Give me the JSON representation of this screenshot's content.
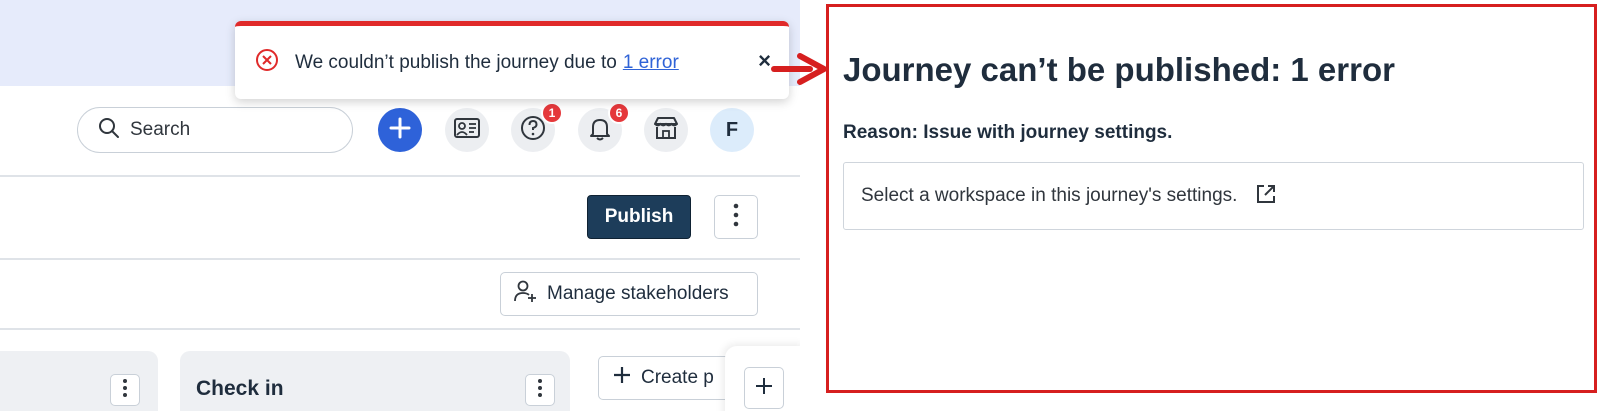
{
  "toast": {
    "message": "We couldn’t publish the journey due to",
    "link": "1 error",
    "close": "×"
  },
  "header": {
    "search_label": "Search",
    "help_badge": "1",
    "notifications_badge": "6",
    "avatar_initial": "F"
  },
  "toolbar": {
    "publish_label": "Publish",
    "manage_stakeholders_label": "Manage stakeholders"
  },
  "stages": [
    {
      "title": ""
    },
    {
      "title": "Check in"
    }
  ],
  "create_button_label": "Create p",
  "error_panel": {
    "title": "Journey can’t be published: 1 error",
    "reason": "Reason: Issue with journey settings.",
    "item": "Select a workspace in this journey's settings."
  },
  "colors": {
    "error_red": "#e02a2a",
    "primary_blue": "#2e62d9",
    "publish_navy": "#1d3d5a",
    "badge_red": "#e5383b",
    "link_blue": "#2f63d7"
  },
  "icons": [
    "error-circle-icon",
    "close-icon",
    "search-icon",
    "plus-icon",
    "contact-card-icon",
    "help-icon",
    "bell-icon",
    "storefront-icon",
    "kebab-icon",
    "add-person-icon",
    "external-link-icon",
    "arrow-right-icon"
  ]
}
